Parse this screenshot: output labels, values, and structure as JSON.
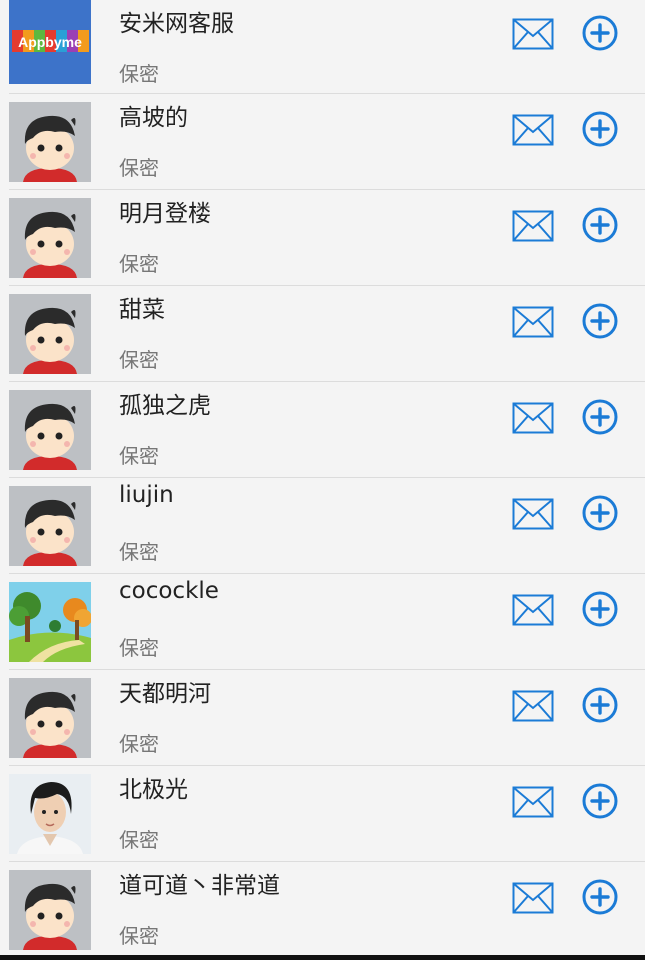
{
  "users": [
    {
      "name": "安米网客服",
      "gender": "保密",
      "avatar": "appbyme-logo",
      "logo_text": "Appbyme"
    },
    {
      "name": "高坡的",
      "gender": "保密",
      "avatar": "default-boy"
    },
    {
      "name": "明月登楼",
      "gender": "保密",
      "avatar": "default-boy"
    },
    {
      "name": "甜菜",
      "gender": "保密",
      "avatar": "default-boy"
    },
    {
      "name": "孤独之虎",
      "gender": "保密",
      "avatar": "default-boy"
    },
    {
      "name": "liujin",
      "gender": "保密",
      "avatar": "default-boy"
    },
    {
      "name": "cocockle",
      "gender": "保密",
      "avatar": "landscape-photo"
    },
    {
      "name": "天都明河",
      "gender": "保密",
      "avatar": "default-boy"
    },
    {
      "name": "北极光",
      "gender": "保密",
      "avatar": "person-photo"
    },
    {
      "name": "道可道丶非常道",
      "gender": "保密",
      "avatar": "default-boy"
    }
  ],
  "icons": {
    "message": "mail-icon",
    "add": "plus-circle-icon"
  },
  "colors": {
    "accent": "#1b7bd6",
    "background": "#f4f4f4",
    "divider": "#dcdcdc"
  }
}
